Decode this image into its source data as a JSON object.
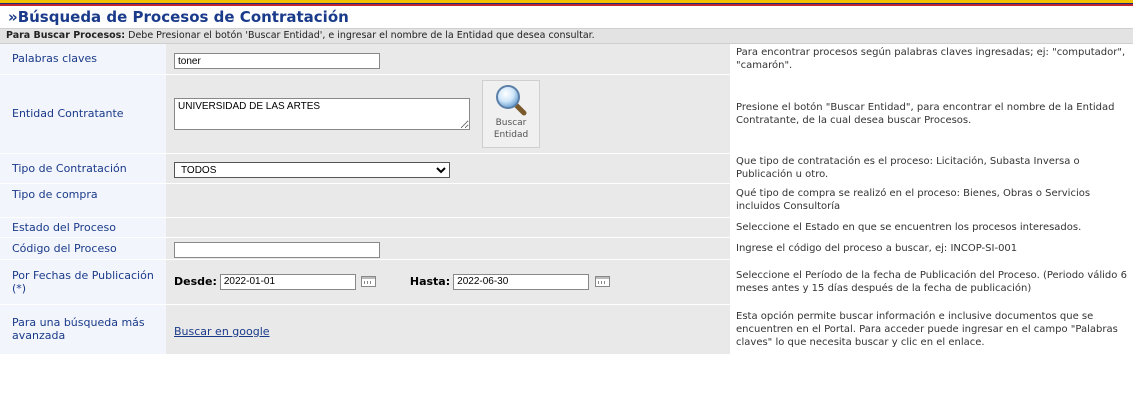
{
  "page": {
    "title": "»Búsqueda de Procesos de Contratación",
    "instructions_bold": "Para Buscar Procesos:",
    "instructions_text": " Debe Presionar el botón 'Buscar Entidad', e ingresar el nombre de la Entidad que desea consultar."
  },
  "rows": {
    "palabras": {
      "label": "Palabras claves",
      "value": "toner",
      "help": "Para encontrar procesos según palabras claves ingresadas; ej: \"computador\", \"camarón\"."
    },
    "entidad": {
      "label": "Entidad Contratante",
      "value": "UNIVERSIDAD DE LAS ARTES",
      "button_line1": "Buscar",
      "button_line2": "Entidad",
      "help": "Presione el botón \"Buscar Entidad\", para encontrar el nombre de la Entidad Contratante, de la cual desea buscar Procesos."
    },
    "tipo_contratacion": {
      "label": "Tipo de Contratación",
      "selected": "TODOS",
      "help": "Que tipo de contratación es el proceso: Licitación, Subasta Inversa o Publicación u otro."
    },
    "tipo_compra": {
      "label": "Tipo de compra",
      "help": "Qué tipo de compra se realizó en el proceso: Bienes, Obras o Servicios incluidos Consultoría"
    },
    "estado": {
      "label": "Estado del Proceso",
      "help": "Seleccione el Estado en que se encuentren los procesos interesados."
    },
    "codigo": {
      "label": "Código del Proceso",
      "value": "",
      "help": "Ingrese el código del proceso a buscar, ej: INCOP-SI-001"
    },
    "fechas": {
      "label": "Por Fechas de Publicación (*)",
      "desde_label": "Desde:",
      "desde_value": "2022-01-01",
      "hasta_label": "Hasta:",
      "hasta_value": "2022-06-30",
      "help": "Seleccione el Período de la fecha de Publicación del Proceso. (Periodo válido 6 meses antes y 15 días después de la fecha de publicación)"
    },
    "avanzada": {
      "label": "Para una búsqueda más avanzada",
      "link": "Buscar en google",
      "help": "Esta opción permite buscar información e inclusive documentos que se encuentren en el Portal. Para acceder puede ingresar en el campo \"Palabras claves\" lo que necesita buscar y clic en el enlace."
    }
  }
}
